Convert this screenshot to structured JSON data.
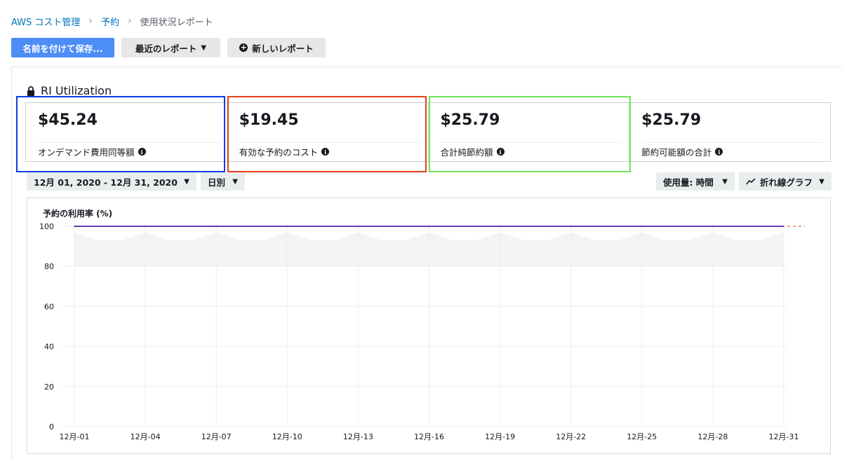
{
  "breadcrumb": {
    "items": [
      "AWS コスト管理",
      "予約",
      "使用状況レポート"
    ]
  },
  "toolbar": {
    "save_label": "名前を付けて保存...",
    "recent_label": "最近のレポート",
    "new_label": "新しいレポート"
  },
  "panel": {
    "title": "RI Utilization"
  },
  "cards": [
    {
      "value": "$45.24",
      "label": "オンデマンド費用同等額"
    },
    {
      "value": "$19.45",
      "label": "有効な予約のコスト"
    },
    {
      "value": "$25.79",
      "label": "合計純節約額"
    },
    {
      "value": "$25.79",
      "label": "節約可能額の合計"
    }
  ],
  "highlight_colors": {
    "blue": "#0a3ee6",
    "red": "#e8401c",
    "green": "#6fe35a"
  },
  "controls": {
    "date_range": "12月 01, 2020 - 12月 31, 2020",
    "granularity": "日別",
    "usage": "使用量: 時間",
    "chart_type": "折れ線グラフ"
  },
  "chart_data": {
    "type": "line",
    "ylabel": "予約の利用率 (%)",
    "ylim": [
      0,
      100
    ],
    "yticks": [
      0,
      20,
      40,
      60,
      80,
      100
    ],
    "x": [
      "12月-01",
      "12月-02",
      "12月-03",
      "12月-04",
      "12月-05",
      "12月-06",
      "12月-07",
      "12月-08",
      "12月-09",
      "12月-10",
      "12月-11",
      "12月-12",
      "12月-13",
      "12月-14",
      "12月-15",
      "12月-16",
      "12月-17",
      "12月-18",
      "12月-19",
      "12月-20",
      "12月-21",
      "12月-22",
      "12月-23",
      "12月-24",
      "12月-25",
      "12月-26",
      "12月-27",
      "12月-28",
      "12月-29",
      "12月-30",
      "12月-31"
    ],
    "xticks": [
      "12月-01",
      "12月-04",
      "12月-07",
      "12月-10",
      "12月-13",
      "12月-16",
      "12月-19",
      "12月-22",
      "12月-25",
      "12月-28",
      "12月-31"
    ],
    "series": [
      {
        "values": [
          100,
          100,
          100,
          100,
          100,
          100,
          100,
          100,
          100,
          100,
          100,
          100,
          100,
          100,
          100,
          100,
          100,
          100,
          100,
          100,
          100,
          100,
          100,
          100,
          100,
          100,
          100,
          100,
          100,
          100,
          100
        ],
        "color": "#6a3ab2"
      }
    ],
    "grid": true
  }
}
